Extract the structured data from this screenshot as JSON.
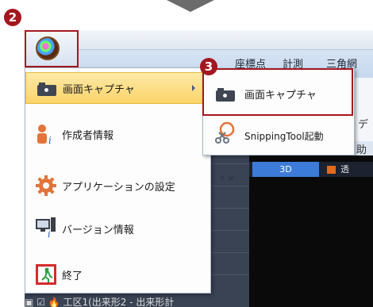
{
  "steps": {
    "step2": "2",
    "step3": "3"
  },
  "menu_bar": {
    "coords": "座標点",
    "measure": "計測",
    "triangle": "三角網"
  },
  "ribbon": {
    "label1": "デ",
    "label2": "助表"
  },
  "app_menu": {
    "items": [
      {
        "label": "画面キャプチャ",
        "icon": "camera-icon",
        "selected": true
      },
      {
        "label": "作成者情報",
        "icon": "author-info-icon"
      },
      {
        "label": "アプリケーションの設定",
        "icon": "gear-icon"
      },
      {
        "label": "バージョン情報",
        "icon": "version-info-icon"
      },
      {
        "label": "終了",
        "icon": "exit-icon"
      }
    ]
  },
  "submenu": {
    "items": [
      {
        "label": "画面キャプチャ",
        "icon": "camera-icon"
      },
      {
        "label": "SnippingTool起動",
        "icon": "scissors-icon"
      }
    ]
  },
  "panel": {
    "pin_close": "ᵖ ✕"
  },
  "view": {
    "tab_3d": "3D",
    "label2": "透"
  },
  "tree": {
    "bottom_item": "▣ ☑ 🔥 工区1(出来形2 - 出来形計"
  },
  "colors": {
    "highlight_red": "#a3171f",
    "selected_menu": "#fbd46a"
  }
}
